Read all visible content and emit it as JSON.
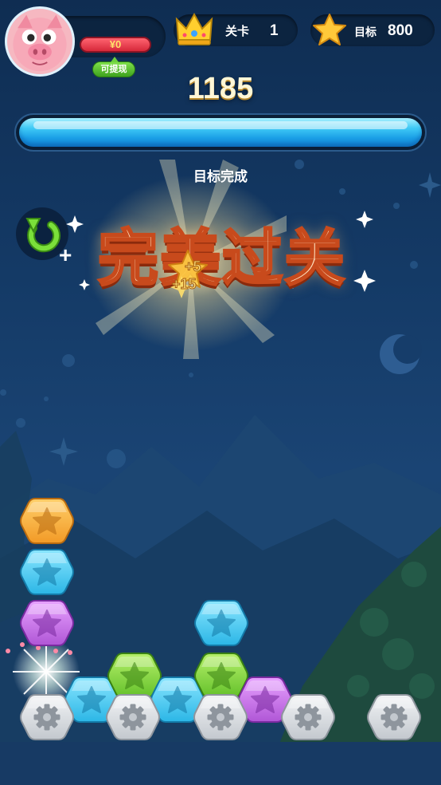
{
  "hud": {
    "cash": "¥0",
    "withdraw_label": "可提现",
    "level_label": "关卡",
    "level_value": "1",
    "goal_label": "目标",
    "goal_value": "800"
  },
  "score": "1185",
  "progress": 1.0,
  "status_text": "目标完成",
  "banner": {
    "title": "完美过关",
    "bonus_1": "+5",
    "bonus_2": "+15"
  },
  "colors": {
    "orange": "#f7a43a",
    "blue": "#35bde8",
    "purple": "#b85ad6",
    "green": "#6cc631",
    "gray": "#c4c9cf"
  },
  "tiles": [
    {
      "color": "orange",
      "icon": "star-icon"
    },
    {
      "color": "blue",
      "icon": "star-icon"
    },
    {
      "color": "purple",
      "icon": "star-icon"
    },
    {
      "color": "blue",
      "icon": "star-icon"
    },
    {
      "color": "green",
      "icon": "star-icon"
    },
    {
      "color": "blue",
      "icon": "star-icon"
    },
    {
      "color": "blue",
      "icon": "star-icon"
    },
    {
      "color": "green",
      "icon": "star-icon"
    },
    {
      "color": "purple",
      "icon": "star-icon"
    },
    {
      "color": "gray",
      "icon": "gear-icon"
    },
    {
      "color": "gray",
      "icon": "gear-icon"
    },
    {
      "color": "gray",
      "icon": "gear-icon"
    },
    {
      "color": "gray",
      "icon": "gear-icon"
    },
    {
      "color": "gray",
      "icon": "gear-icon"
    }
  ]
}
